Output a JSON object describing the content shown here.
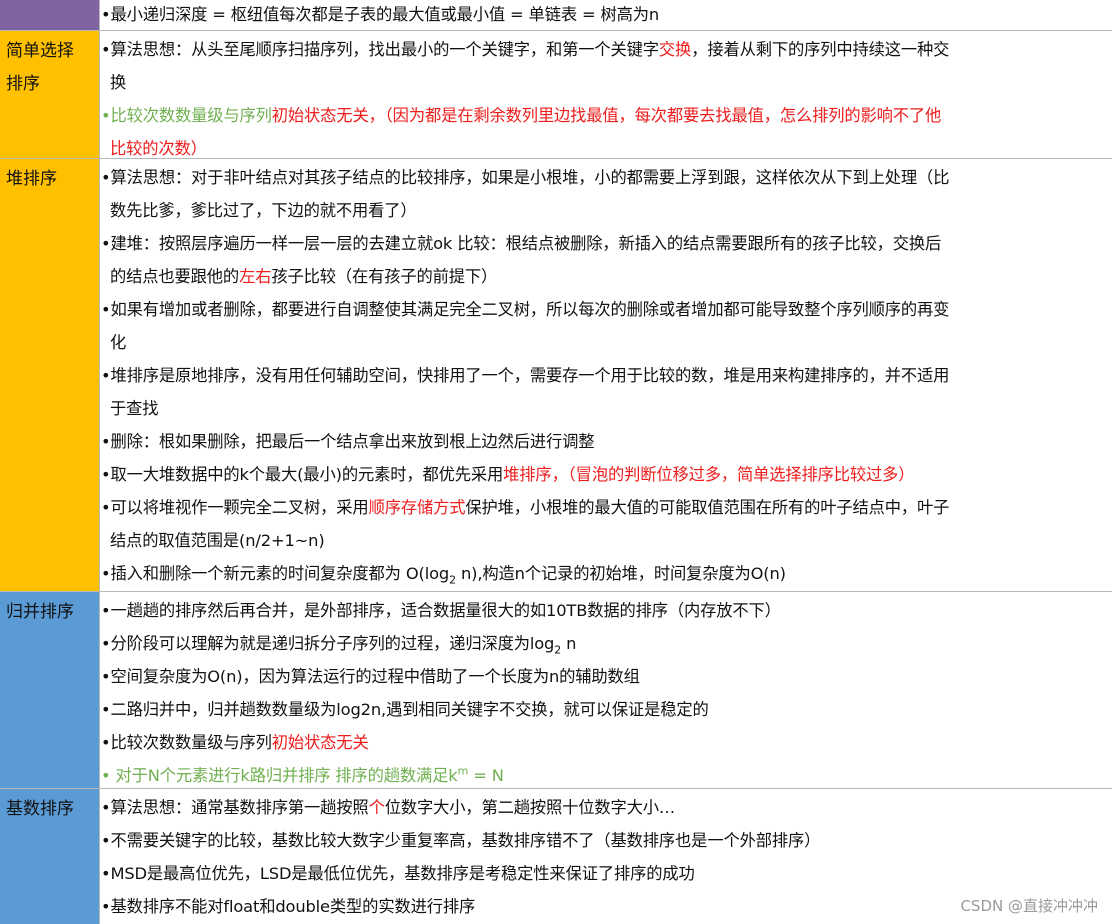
{
  "colors": {
    "purple": "#8064a2",
    "yellow": "#ffc000",
    "blue": "#5b9bd5",
    "red": "#ee1c1c",
    "green": "#70b050"
  },
  "rows": {
    "r0": {
      "label": "",
      "l1": "•最小递归深度 = 枢纽值每次都是子表的最大值或最小值 = 单链表 = 树高为n"
    },
    "r1": {
      "label_a": "简单选择",
      "label_b": "排序",
      "l1a": "•算法思想：从头至尾顺序扫描序列，找出最小的一个关键字，和第一个关键字",
      "l1b": "交换",
      "l1c": "，接着从剩下的序列中持续这一种交",
      "l2": "换",
      "l3a": "•比较次数数量级与序列",
      "l3b": "初始状态无关，（因为都是在剩余数列里边找最值，每次都要去找最值，怎么排列的影响不了他",
      "l4": "比较的次数）"
    },
    "r2": {
      "label": "堆排序",
      "l1": "•算法思想：对于非叶结点对其孩子结点的比较排序，如果是小根堆，小的都需要上浮到跟，这样依次从下到上处理（比",
      "l2": "数先比爹，爹比过了，下边的就不用看了）",
      "l3": "•建堆：按照层序遍历一样一层一层的去建立就ok 比较：根结点被删除，新插入的结点需要跟所有的孩子比较，交换后",
      "l4a": "的结点也要跟他的",
      "l4b": "左右",
      "l4c": "孩子比较（在有孩子的前提下）",
      "l5": "•如果有增加或者删除，都要进行自调整使其满足完全二叉树，所以每次的删除或者增加都可能导致整个序列顺序的再变",
      "l6": "化",
      "l7": "•堆排序是原地排序，没有用任何辅助空间，快排用了一个，需要存一个用于比较的数，堆是用来构建排序的，并不适用",
      "l8": "于查找",
      "l9": "•删除：根如果删除，把最后一个结点拿出来放到根上边然后进行调整",
      "l10a": "•取一大堆数据中的k个最大(最小)的元素时，都优先采用",
      "l10b": "堆排序，（冒泡的判断位移过多，简单选择排序比较过多）",
      "l11a": "•可以将堆视作一颗完全二叉树，采用",
      "l11b": "顺序存储方式",
      "l11c": "保护堆，小根堆的最大值的可能取值范围在所有的叶子结点中，叶子",
      "l12": "结点的取值范围是(n/2+1~n)",
      "l13a": "•插入和删除一个新元素的时间复杂度都为 O(log",
      "l13sub": "2",
      "l13b": " n),构造n个记录的初始堆，时间复杂度为O(n)"
    },
    "r3": {
      "label": "归并排序",
      "l1": "•一趟趟的排序然后再合并，是外部排序，适合数据量很大的如10TB数据的排序（内存放不下）",
      "l2a": "•分阶段可以理解为就是递归拆分子序列的过程，递归深度为log",
      "l2sub": "2",
      "l2b": " n",
      "l3": "•空间复杂度为O(n)，因为算法运行的过程中借助了一个长度为n的辅助数组",
      "l4": "•二路归并中，归并趟数数量级为log2n,遇到相同关键字不交换，就可以保证是稳定的",
      "l5a": "•比较次数数量级与序列",
      "l5b": "初始状态无关",
      "l6a": "• 对于N个元素进行k路归并排序  排序的趟数满足k",
      "l6sup": "m",
      "l6b": " = N"
    },
    "r4": {
      "label": "基数排序",
      "l1a": "•算法思想：通常基数排序第一趟按照",
      "l1b": "个",
      "l1c": "位数字大小，第二趟按照十位数字大小…",
      "l2": "•不需要关键字的比较，基数比较大数字少重复率高，基数排序错不了（基数排序也是一个外部排序）",
      "l3": "•MSD是最高位优先，LSD是最低位优先，基数排序是考稳定性来保证了排序的成功",
      "l4": "•基数排序不能对float和double类型的实数进行排序"
    }
  },
  "watermark": "CSDN @直接冲冲冲"
}
